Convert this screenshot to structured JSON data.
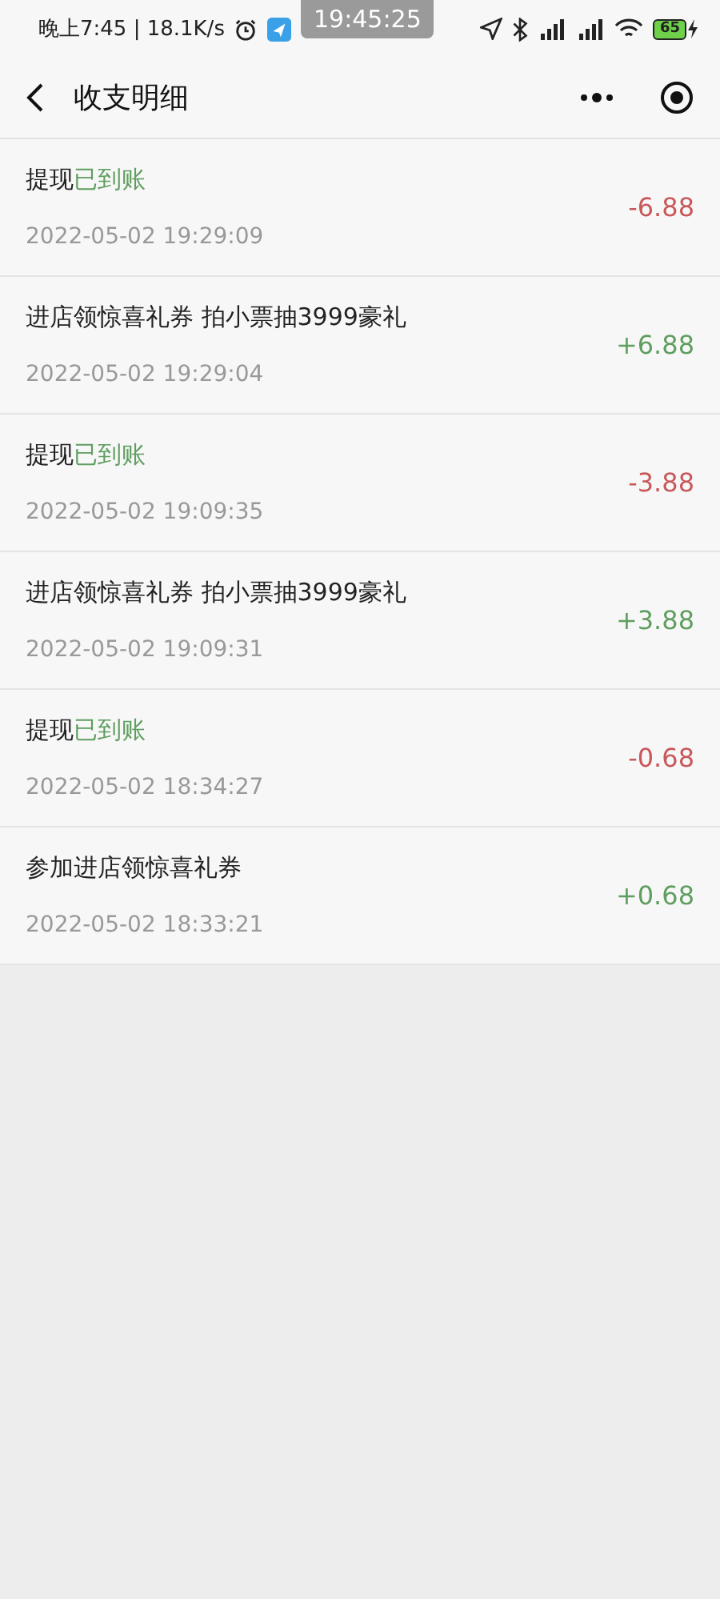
{
  "status_bar": {
    "time": "晚上7:45 | 18.1K/s",
    "overlay_clock": "19:45:25",
    "battery": "65"
  },
  "nav": {
    "title": "收支明细"
  },
  "records": [
    {
      "title": "提现",
      "status": "已到账",
      "time": "2022-05-02 19:29:09",
      "amount": "-6.88",
      "kind": "expense"
    },
    {
      "title": "进店领惊喜礼券 拍小票抽3999豪礼",
      "time": "2022-05-02 19:29:04",
      "amount": "+6.88",
      "kind": "income"
    },
    {
      "title": "提现",
      "status": "已到账",
      "time": "2022-05-02 19:09:35",
      "amount": "-3.88",
      "kind": "expense"
    },
    {
      "title": "进店领惊喜礼券 拍小票抽3999豪礼",
      "time": "2022-05-02 19:09:31",
      "amount": "+3.88",
      "kind": "income"
    },
    {
      "title": "提现",
      "status": "已到账",
      "time": "2022-05-02 18:34:27",
      "amount": "-0.68",
      "kind": "expense"
    },
    {
      "title": "参加进店领惊喜礼券",
      "time": "2022-05-02 18:33:21",
      "amount": "+0.68",
      "kind": "income"
    }
  ]
}
